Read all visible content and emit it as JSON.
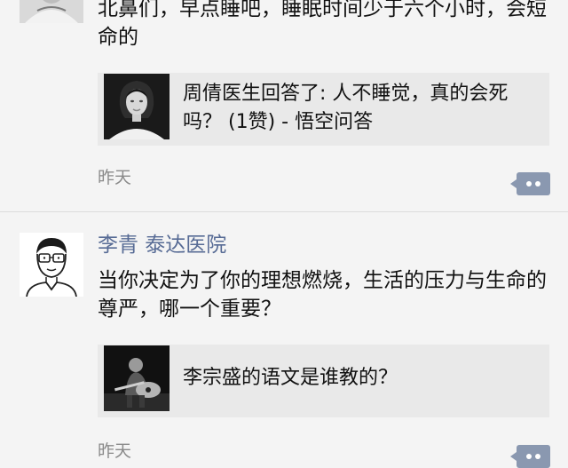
{
  "feed": {
    "posts": [
      {
        "author": "",
        "text": "北鼻们，早点睡吧，睡眠时间少于六个小时，会短命的",
        "link": {
          "title": "周倩医生回答了: 人不睡觉，真的会死吗？ (1赞) - 悟空问答",
          "thumb_icon": "woman-portrait-thumbnail"
        },
        "time": "昨天",
        "action_icon": "comment-more-icon"
      },
      {
        "author": "李青 泰达医院",
        "text": "当你决定为了你的理想燃烧，生活的压力与生命的尊严，哪一个重要？",
        "link": {
          "title": "李宗盛的语文是谁教的？",
          "thumb_icon": "guitarist-photo-thumbnail"
        },
        "time": "昨天",
        "action_icon": "comment-more-icon"
      }
    ]
  },
  "colors": {
    "background": "#f4f4f4",
    "author_name": "#576b95",
    "link_card": "#e9e9e9",
    "timestamp": "#8a8a8a",
    "comment_button": "#8a98b0"
  }
}
